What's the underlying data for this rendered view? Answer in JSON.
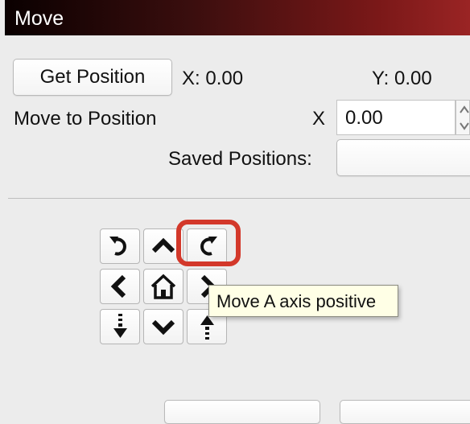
{
  "window": {
    "title": "Move"
  },
  "position": {
    "get_position_label": "Get Position",
    "x_readout": "X: 0.00",
    "y_readout": "Y: 0.00"
  },
  "move_to": {
    "label": "Move to Position",
    "x_label": "X",
    "x_value": "0.00"
  },
  "saved": {
    "label": "Saved Positions:"
  },
  "jog": {
    "buttons": [
      {
        "icon": "rotate-ccw-icon",
        "tooltip": ""
      },
      {
        "icon": "chevron-up-icon",
        "tooltip": ""
      },
      {
        "icon": "rotate-cw-icon",
        "tooltip": "Move A axis positive"
      },
      {
        "icon": "chevron-left-icon",
        "tooltip": ""
      },
      {
        "icon": "home-icon",
        "tooltip": ""
      },
      {
        "icon": "chevron-right-icon",
        "tooltip": ""
      },
      {
        "icon": "z-down-icon",
        "tooltip": ""
      },
      {
        "icon": "chevron-down-icon",
        "tooltip": ""
      },
      {
        "icon": "z-up-icon",
        "tooltip": ""
      }
    ],
    "tooltip": "Move A axis positive",
    "highlight_color": "#d3382a"
  }
}
